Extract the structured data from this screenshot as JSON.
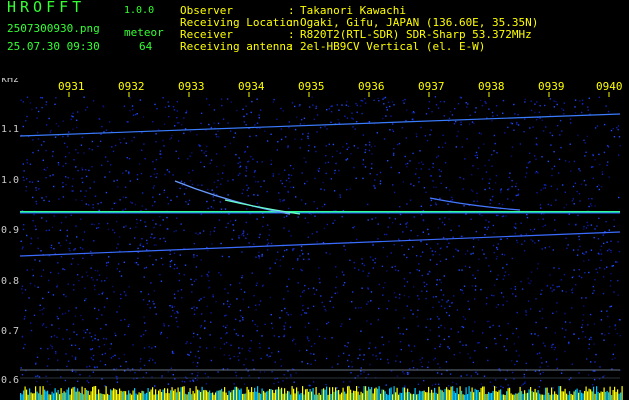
{
  "app": {
    "name": "HROFFT",
    "version": "1.0.0"
  },
  "file": {
    "name": "2507300930.png",
    "datetime": "25.07.30 09:30"
  },
  "meteor": {
    "label": "meteor",
    "count": "64"
  },
  "metadata": [
    {
      "label": "Observer",
      "value": "Takanori Kawachi"
    },
    {
      "label": "Receiving Location",
      "value": "Ogaki, Gifu, JAPAN (136.60E, 35.35N)"
    },
    {
      "label": "Receiver",
      "value": "R820T2(RTL-SDR) SDR-Sharp 53.372MHz"
    },
    {
      "label": "Receiving antenna",
      "value": "2el-HB9CV Vertical (el. E-W)"
    }
  ],
  "colon": ":",
  "axis": {
    "y_unit": "kHz",
    "y_ticks": [
      "1.1",
      "1.0",
      "0.9",
      "0.8",
      "0.7",
      "0.6"
    ],
    "x_ticks": [
      "0931",
      "0932",
      "0933",
      "0934",
      "0935",
      "0936",
      "0937",
      "0938",
      "0939",
      "0940"
    ]
  },
  "colors": {
    "background": "#000000",
    "noise": "#0a0a8c",
    "signal": "#33ff99",
    "label_green": "#33ff33",
    "label_yellow": "#ffff00",
    "bar_yellow": "#ffff00",
    "bar_cyan": "#00ccff"
  }
}
